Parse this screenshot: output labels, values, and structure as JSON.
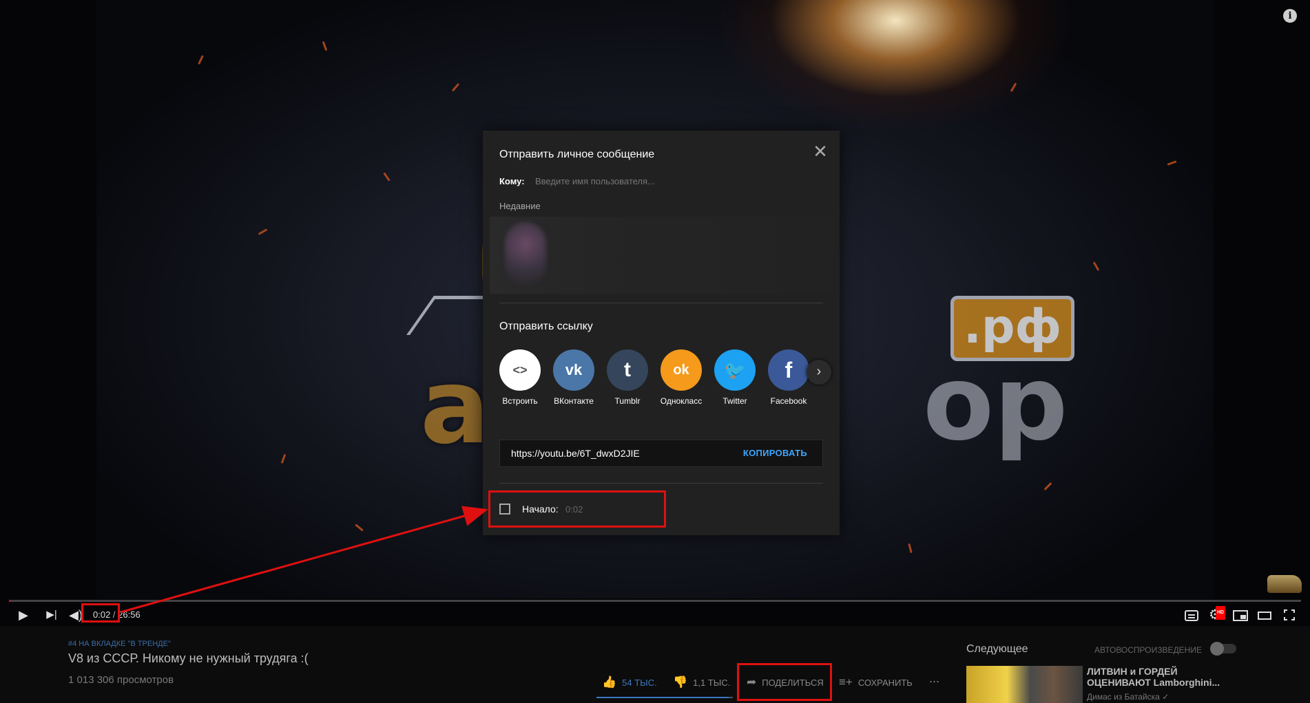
{
  "player": {
    "current_time": "0:02",
    "duration": "26:56",
    "time_separator": " / ",
    "progress_fraction": 0.0012,
    "icons": [
      "play-icon",
      "next-icon",
      "volume-icon",
      "subtitles-icon",
      "settings-icon",
      "miniplayer-icon",
      "theater-icon",
      "fullscreen-icon",
      "info-icon"
    ],
    "hd_badge": "HD",
    "info_glyph": "i",
    "logo_text_left": "авт",
    "logo_text_right": "ор",
    "logo_rf": ".рф"
  },
  "share_dialog": {
    "title": "Отправить личное сообщение",
    "to_label": "Кому:",
    "to_placeholder": "Введите имя пользователя...",
    "recent_label": "Недавние",
    "send_link_label": "Отправить ссылку",
    "targets": [
      {
        "label": "Встроить",
        "icon": "embed-icon",
        "glyph": "<>",
        "color": "#ffffff",
        "glyph_color": "#555555"
      },
      {
        "label": "ВКонтакте",
        "icon": "vk-icon",
        "glyph": "vk",
        "color": "#4a76a8",
        "glyph_color": "#ffffff"
      },
      {
        "label": "Tumblr",
        "icon": "tumblr-icon",
        "glyph": "t",
        "color": "#35465c",
        "glyph_color": "#ffffff"
      },
      {
        "label": "Однокласс",
        "icon": "odnoklassniki-icon",
        "glyph": "ok",
        "color": "#f59a1b",
        "glyph_color": "#ffffff"
      },
      {
        "label": "Twitter",
        "icon": "twitter-icon",
        "glyph": "🐦",
        "color": "#1da1f2",
        "glyph_color": "#ffffff"
      },
      {
        "label": "Facebook",
        "icon": "facebook-icon",
        "glyph": "f",
        "color": "#3b5998",
        "glyph_color": "#ffffff"
      }
    ],
    "url": "https://youtu.be/6T_dwxD2JIE",
    "copy_label": "КОПИРОВАТЬ",
    "start_label": "Начало:",
    "start_value": "0:02",
    "start_checked": false
  },
  "video_info": {
    "trending": "#4 НА ВКЛАДКЕ \"В ТРЕНДЕ\"",
    "title": "V8 из СССР. Никому не нужный трудяга :(",
    "views": "1 013 306 просмотров",
    "likes": "54 ТЫС.",
    "dislikes": "1,1 ТЫС.",
    "share_label": "ПОДЕЛИТЬСЯ",
    "save_label": "СОХРАНИТЬ",
    "more_label": "..."
  },
  "sidebar": {
    "next_label": "Следующее",
    "autoplay_label": "АВТОВОСПРОИЗВЕДЕНИЕ",
    "autoplay_on": false,
    "recommendation": {
      "title": "ЛИТВИН и ГОРДЕЙ ОЦЕНИВАЮТ Lamborghini...",
      "channel": "Димас из Батайска",
      "verified_glyph": "✓"
    }
  },
  "annotations": {
    "highlight_color": "#e01010"
  }
}
